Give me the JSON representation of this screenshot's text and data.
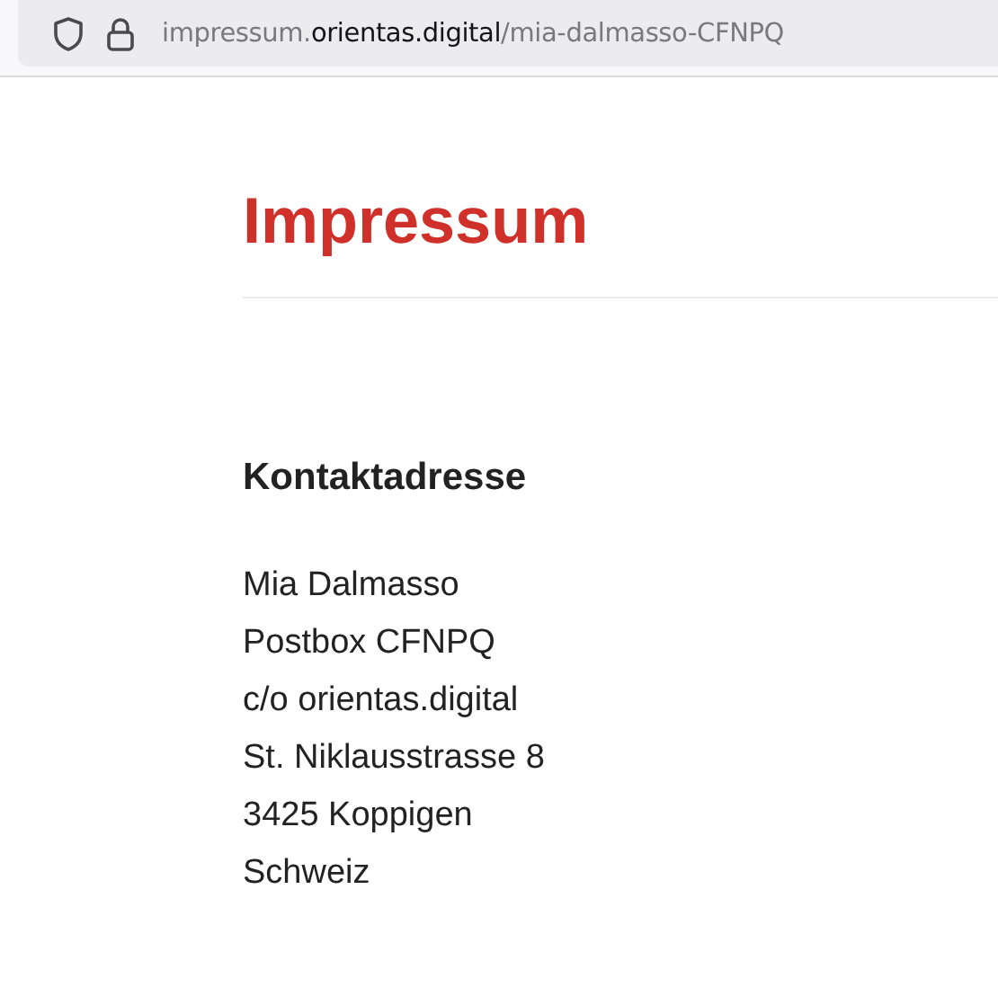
{
  "address_bar": {
    "url_prefix": "impressum.",
    "url_domain": "orientas.digital",
    "url_path": "/mia-dalmasso-CFNPQ"
  },
  "page": {
    "title": "Impressum",
    "section_heading": "Kontaktadresse",
    "address_lines": [
      "Mia Dalmasso",
      "Postbox CFNPQ",
      "c/o orientas.digital",
      "St. Niklausstrasse 8",
      "3425 Koppigen",
      "Schweiz"
    ]
  }
}
